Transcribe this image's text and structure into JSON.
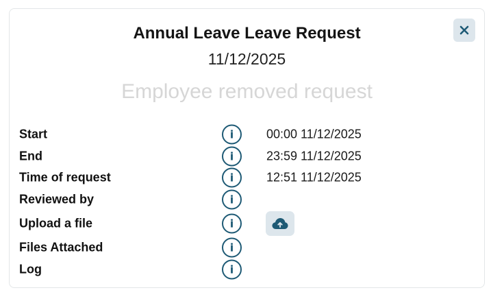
{
  "dialog": {
    "title": "Annual Leave Leave Request",
    "date": "11/12/2025",
    "status": "Employee removed request",
    "close_icon": "close-icon",
    "accent_color": "#1e5a75",
    "status_color": "#d6d6d6"
  },
  "rows": [
    {
      "label": "Start",
      "value": "00:00 11/12/2025"
    },
    {
      "label": "End",
      "value": "23:59 11/12/2025"
    },
    {
      "label": "Time of request",
      "value": "12:51 11/12/2025"
    },
    {
      "label": "Reviewed by",
      "value": ""
    },
    {
      "label": "Upload a file",
      "value": "",
      "action_icon": "cloud-upload-icon"
    },
    {
      "label": "Files Attached",
      "value": ""
    },
    {
      "label": "Log",
      "value": ""
    }
  ],
  "info_icon_glyph": "i"
}
